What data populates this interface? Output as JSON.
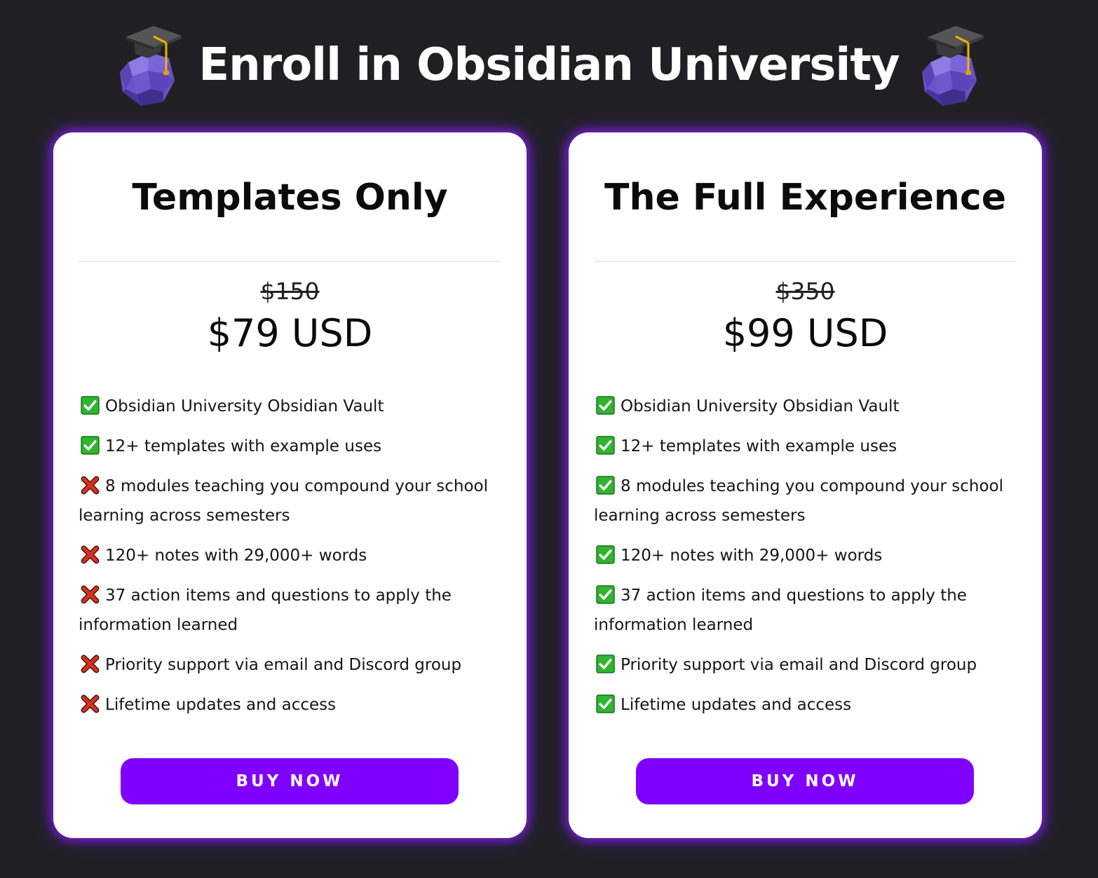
{
  "header": {
    "title": "Enroll in Obsidian University",
    "icon": "obsidian-graduate-icon"
  },
  "colors": {
    "background": "#202024",
    "card": "#ffffff",
    "accent": "#8000ff",
    "glow": "#7a1fe0",
    "check_green": "#2fb52f",
    "cross_red": "#d9301c"
  },
  "plans": [
    {
      "title": "Templates Only",
      "old_price": "$150",
      "price": "$79 USD",
      "features": [
        {
          "included": true,
          "icon": "check-mark-icon",
          "text": "Obsidian University Obsidian Vault"
        },
        {
          "included": true,
          "icon": "check-mark-icon",
          "text": "12+ templates with example uses"
        },
        {
          "included": false,
          "icon": "cross-mark-icon",
          "text": "8 modules teaching you compound your school learning across semesters"
        },
        {
          "included": false,
          "icon": "cross-mark-icon",
          "text": "120+ notes with 29,000+ words"
        },
        {
          "included": false,
          "icon": "cross-mark-icon",
          "text": "37 action items and questions to apply the information learned"
        },
        {
          "included": false,
          "icon": "cross-mark-icon",
          "text": "Priority support via email and Discord group"
        },
        {
          "included": false,
          "icon": "cross-mark-icon",
          "text": "Lifetime updates and access"
        }
      ],
      "button_label": "BUY NOW"
    },
    {
      "title": "The Full Experience",
      "old_price": "$350",
      "price": "$99 USD",
      "features": [
        {
          "included": true,
          "icon": "check-mark-icon",
          "text": "Obsidian University Obsidian Vault"
        },
        {
          "included": true,
          "icon": "check-mark-icon",
          "text": "12+ templates with example uses"
        },
        {
          "included": true,
          "icon": "check-mark-icon",
          "text": "8 modules teaching you compound your school learning across semesters"
        },
        {
          "included": true,
          "icon": "check-mark-icon",
          "text": "120+ notes with 29,000+ words"
        },
        {
          "included": true,
          "icon": "check-mark-icon",
          "text": "37 action items and questions to apply the information learned"
        },
        {
          "included": true,
          "icon": "check-mark-icon",
          "text": "Priority support via email and Discord group"
        },
        {
          "included": true,
          "icon": "check-mark-icon",
          "text": "Lifetime updates and access"
        }
      ],
      "button_label": "BUY NOW"
    }
  ]
}
